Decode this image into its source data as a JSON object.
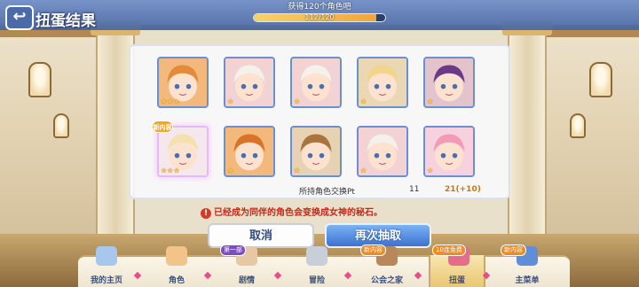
{
  "header": {
    "back_glyph": "↩",
    "title": "扭蛋结果",
    "progress_title": "获得120个角色吧",
    "progress_text": "112/120",
    "progress_value": 0.933
  },
  "results": {
    "cards": [
      {
        "id": "c1",
        "stars": "★★★",
        "color": "#f2b87c",
        "hair": "#e58a3a"
      },
      {
        "id": "c2",
        "stars": "★",
        "color": "#f2d2d2",
        "hair": "#f5f0ea"
      },
      {
        "id": "c3",
        "stars": "★",
        "color": "#f2d2d2",
        "hair": "#f5f0ea"
      },
      {
        "id": "c4",
        "stars": "★",
        "color": "#ead7b4",
        "hair": "#f0d58a"
      },
      {
        "id": "c5",
        "stars": "★",
        "color": "#e3c3cc",
        "hair": "#6a3a86"
      },
      {
        "id": "c6",
        "stars": "★★★",
        "color": "#f5e7ee",
        "hair": "#f3e2b0",
        "new": "新内容"
      },
      {
        "id": "c7",
        "stars": "★",
        "color": "#f2b87c",
        "hair": "#d8742a"
      },
      {
        "id": "c8",
        "stars": "★",
        "color": "#e8d2b4",
        "hair": "#a9743e"
      },
      {
        "id": "c9",
        "stars": "★",
        "color": "#f2d2d2",
        "hair": "#f5f0ea"
      },
      {
        "id": "c10",
        "stars": "★",
        "color": "#f7d2de",
        "hair": "#f29bb8"
      }
    ]
  },
  "pt": {
    "label": "所持角色交换Pt",
    "old_value": "11",
    "new_value": "21(+10)"
  },
  "notice": {
    "mark": "!",
    "text": "已经成为同伴的角色会变换成女神的秘石。"
  },
  "buttons": {
    "cancel": "取消",
    "again": "再次抽取"
  },
  "nav": {
    "items": [
      {
        "label": "我的主页",
        "icon_color": "#a9c6ec"
      },
      {
        "label": "角色",
        "icon_color": "#f2c48a"
      },
      {
        "label": "剧情",
        "icon_color": "#e6c9a4",
        "badge": "第一部"
      },
      {
        "label": "冒险",
        "icon_color": "#c9cfd9"
      },
      {
        "label": "公会之家",
        "icon_color": "#b8875b",
        "badge": "新内容"
      },
      {
        "label": "扭蛋",
        "icon_color": "#e46d8b",
        "badge": "10连免费",
        "active": true
      },
      {
        "label": "主菜单",
        "icon_color": "#5f8ed8",
        "badge": "新内容"
      }
    ]
  },
  "colors": {
    "header": "#4766a3",
    "accent_blue": "#3b72d2",
    "notice_red": "#c5281b",
    "pt_gold": "#c27a14"
  }
}
